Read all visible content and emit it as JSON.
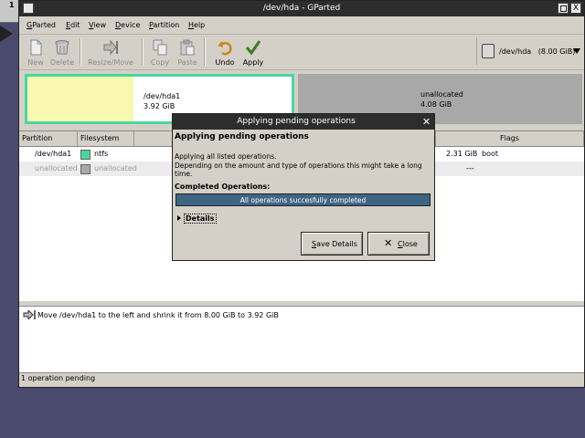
{
  "desktop": {
    "pager_number": "1"
  },
  "window": {
    "title": "/dev/hda - GParted",
    "close_glyph": "X"
  },
  "menubar": {
    "items": [
      "GParted",
      "Edit",
      "View",
      "Device",
      "Partition",
      "Help"
    ]
  },
  "toolbar": {
    "buttons": [
      {
        "label": "New",
        "icon": "new-document-icon",
        "enabled": false
      },
      {
        "label": "Delete",
        "icon": "trash-icon",
        "enabled": false
      },
      {
        "label": "Resize/Move",
        "icon": "resize-move-icon",
        "enabled": false
      },
      {
        "label": "Copy",
        "icon": "copy-icon",
        "enabled": false
      },
      {
        "label": "Paste",
        "icon": "paste-icon",
        "enabled": false
      },
      {
        "label": "Undo",
        "icon": "undo-icon",
        "enabled": true
      },
      {
        "label": "Apply",
        "icon": "apply-check-icon",
        "enabled": true
      }
    ],
    "device": "/dev/hda   (8.00 GiB)"
  },
  "disk_map": {
    "partitions": [
      {
        "name": "/dev/hda1",
        "size": "3.92 GiB",
        "used_fraction": 0.4
      },
      {
        "name": "unallocated",
        "size": "4.08 GiB"
      }
    ]
  },
  "partition_list": {
    "columns": [
      "Partition",
      "Filesystem",
      "Flags"
    ],
    "rows": [
      {
        "partition": "/dev/hda1",
        "filesystem": "ntfs",
        "value": "2.31 GiB",
        "flags": "boot",
        "color": "#4ad6a0"
      },
      {
        "partition": "unallocated",
        "filesystem": "unallocated",
        "value": "---",
        "flags": "",
        "color": "#a8a8a8"
      }
    ]
  },
  "pending_operations": {
    "items": [
      {
        "text": "Move /dev/hda1 to the left and shrink it from 8.00 GiB to 3.92 GiB"
      }
    ]
  },
  "status": {
    "text": "1 operation pending"
  },
  "dialog": {
    "title": "Applying pending operations",
    "close_glyph": "✕",
    "heading": "Applying pending operations",
    "line1": "Applying all listed operations.",
    "line2": "Depending on the amount and type of operations this might take a long time.",
    "completed_label": "Completed Operations:",
    "progress_text": "All operations succesfully completed",
    "progress_fraction": 1.0,
    "details_label": "Details",
    "save_button": "Save Details",
    "close_button": "Close"
  },
  "colors": {
    "ntfs": "#4ad6a0",
    "unallocated": "#a8a8a8",
    "used_space": "#f8f8b0",
    "progress": "#3f6585",
    "titlebar": "#2d2d2d"
  }
}
